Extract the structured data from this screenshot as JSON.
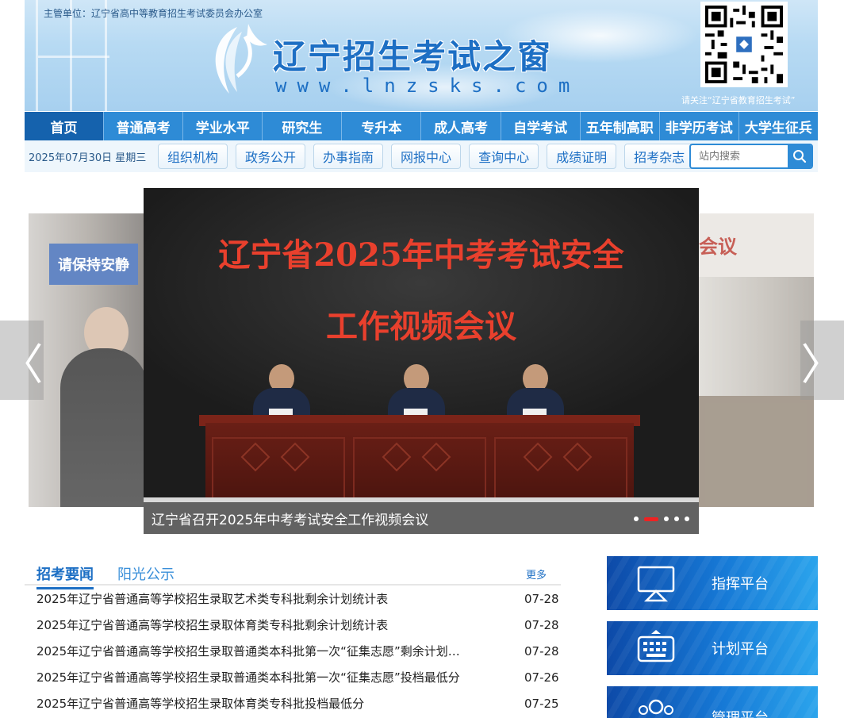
{
  "header": {
    "supervisor": "主管单位：辽宁省高中等教育招生考试委员会办公室",
    "title": "辽宁招生考试之窗",
    "url": "www.lnzsks.com",
    "qr_caption": "请关注“辽宁省教育招生考试”"
  },
  "main_nav": {
    "items": [
      {
        "label": "首页",
        "active": true
      },
      {
        "label": "普通高考"
      },
      {
        "label": "学业水平"
      },
      {
        "label": "研究生"
      },
      {
        "label": "专升本"
      },
      {
        "label": "成人高考"
      },
      {
        "label": "自学考试"
      },
      {
        "label": "五年制高职"
      },
      {
        "label": "非学历考试"
      },
      {
        "label": "大学生征兵"
      }
    ]
  },
  "sub_nav": {
    "date": "2025年07月30日 星期三",
    "buttons": [
      "组织机构",
      "政务公开",
      "办事指南",
      "网报中心",
      "查询中心",
      "成绩证明",
      "招考杂志"
    ],
    "search_placeholder": "站内搜索"
  },
  "carousel": {
    "heading_line1": "辽宁省2025年中考考试安全",
    "heading_line2": "工作视频会议",
    "caption": "辽宁省召开2025年中考考试安全工作视频会议",
    "left_sign": "请保持安静",
    "right_wall_text": "会议",
    "prev_arrow": "〈",
    "next_arrow": "〉",
    "dot_count": 5,
    "active_dot": 1
  },
  "news": {
    "tabs": [
      "招考要闻",
      "阳光公示"
    ],
    "more": "更多",
    "items": [
      {
        "title": "2025年辽宁省普通高等学校招生录取艺术类专科批剩余计划统计表",
        "date": "07-28"
      },
      {
        "title": "2025年辽宁省普通高等学校招生录取体育类专科批剩余计划统计表",
        "date": "07-28"
      },
      {
        "title": "2025年辽宁省普通高等学校招生录取普通类本科批第一次“征集志愿”剩余计划…",
        "date": "07-28"
      },
      {
        "title": "2025年辽宁省普通高等学校招生录取普通类本科批第一次“征集志愿”投档最低分",
        "date": "07-26"
      },
      {
        "title": "2025年辽宁省普通高等学校招生录取体育类专科批投档最低分",
        "date": "07-25"
      }
    ]
  },
  "platforms": [
    {
      "label": "指挥平台",
      "icon": "monitor-icon"
    },
    {
      "label": "计划平台",
      "icon": "keyboard-icon"
    },
    {
      "label": "管理平台",
      "icon": "people-icon"
    }
  ],
  "colors": {
    "primary": "#2e8bd6",
    "nav_active": "#1562ad",
    "accent_red": "#e9402d"
  }
}
